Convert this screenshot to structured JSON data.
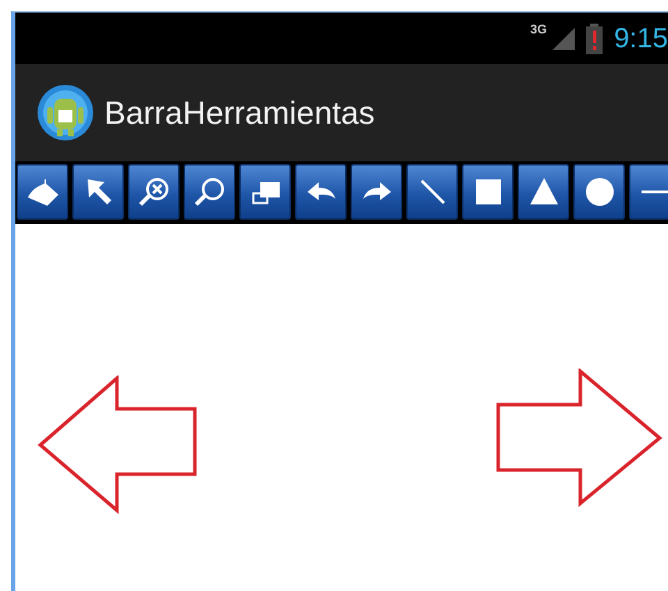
{
  "status_bar": {
    "network": "3G",
    "time": "9:15"
  },
  "action_bar": {
    "title": "BarraHerramientas"
  }
}
